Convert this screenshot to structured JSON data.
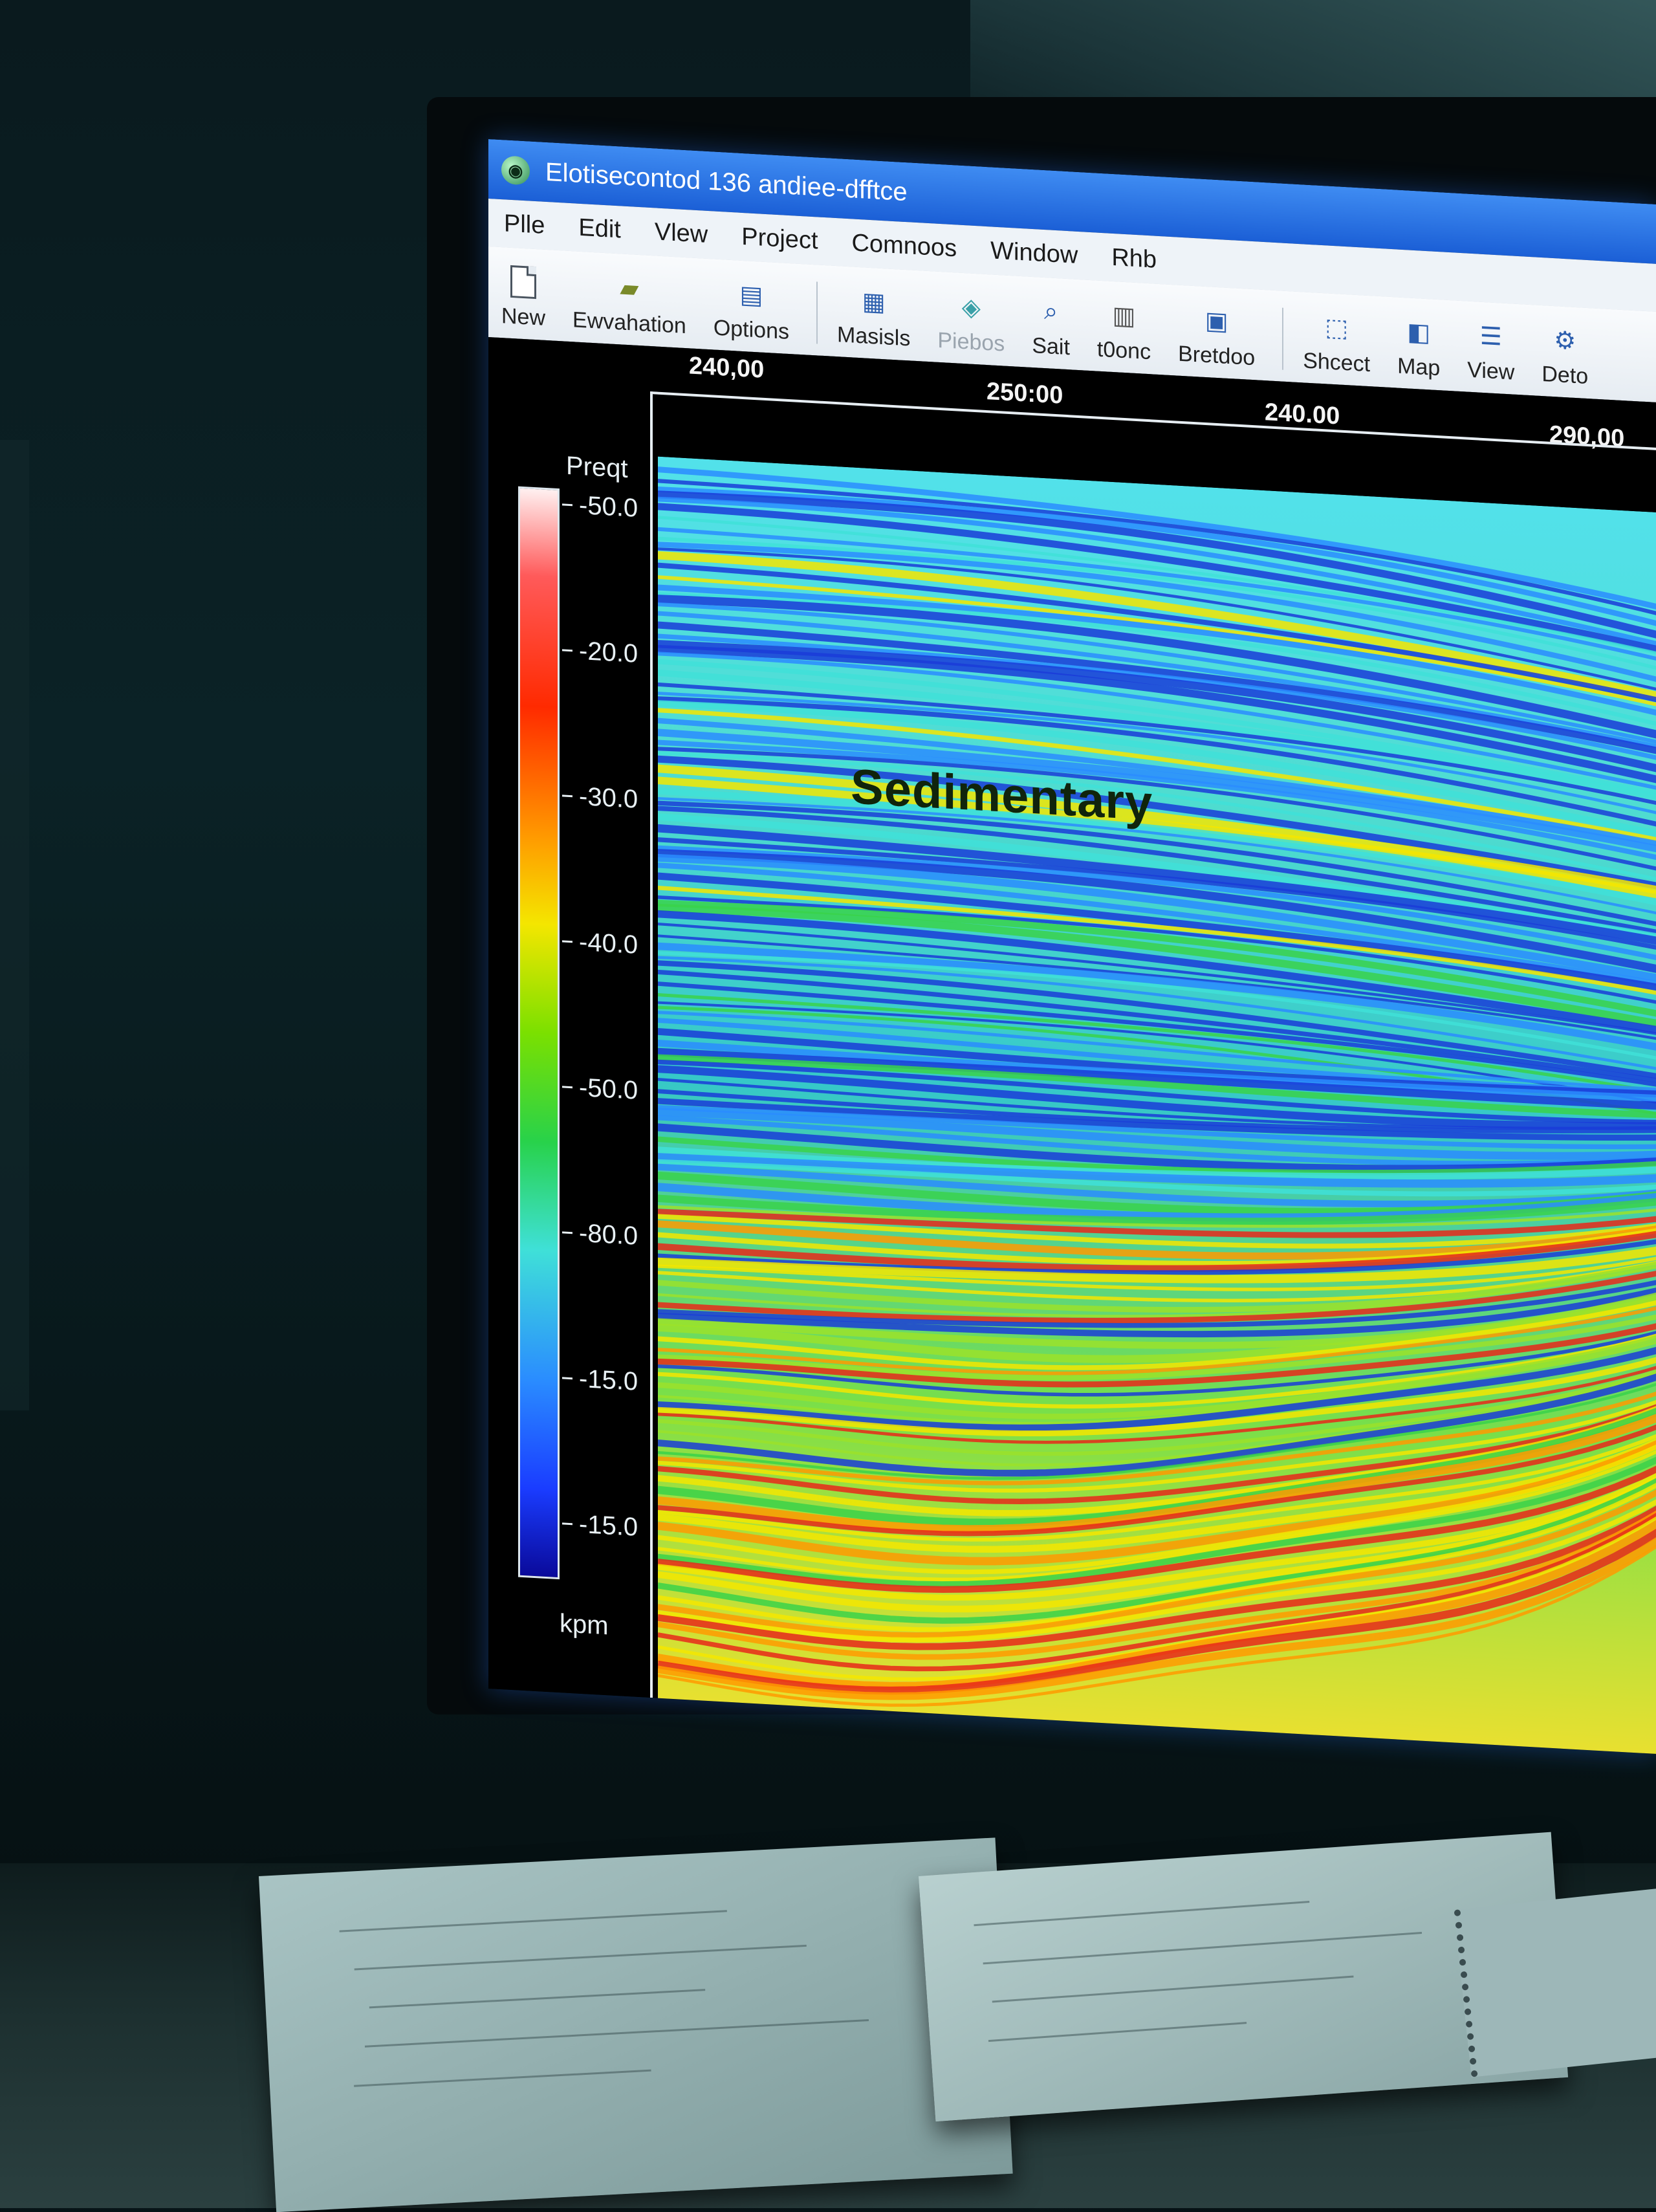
{
  "window": {
    "title": "Elotisecontod 136 andiee-dfftce",
    "app_icon": "app-globe-icon"
  },
  "menu": [
    "Plle",
    "Edit",
    "Vlew",
    "Project",
    "Comnoos",
    "Window",
    "Rhb"
  ],
  "toolbar": [
    {
      "label": "New",
      "icon": "new-document-icon"
    },
    {
      "label": "Ewvahation",
      "icon": "folder-icon"
    },
    {
      "label": "Options",
      "icon": "options-icon"
    },
    {
      "label": "Masisls",
      "icon": "grid-icon"
    },
    {
      "label": "Piebos",
      "icon": "layers-icon",
      "disabled": true
    },
    {
      "label": "Sait",
      "icon": "zoom-icon"
    },
    {
      "label": "t0onc",
      "icon": "grid-lines-icon"
    },
    {
      "label": "Bretdoo",
      "icon": "image-icon"
    },
    {
      "label": "Shcect",
      "icon": "select-icon"
    },
    {
      "label": "Map",
      "icon": "map-icon"
    },
    {
      "label": "View",
      "icon": "view-icon"
    },
    {
      "label": "Deto",
      "icon": "gear-icon"
    }
  ],
  "axis": {
    "x_ticks": [
      "240,00",
      "250:00",
      "240.00",
      "290,00"
    ]
  },
  "colorbar": {
    "title": "Preqt",
    "ticks": [
      "-50.0",
      "-20.0",
      "-30.0",
      "-40.0",
      "-50.0",
      "-80.0",
      "-15.0",
      "-15.0"
    ],
    "unit": "kpm"
  },
  "annotation": "Sedimentary",
  "colors": {
    "title_bar": "#1b5fd6",
    "background": "#000000"
  }
}
